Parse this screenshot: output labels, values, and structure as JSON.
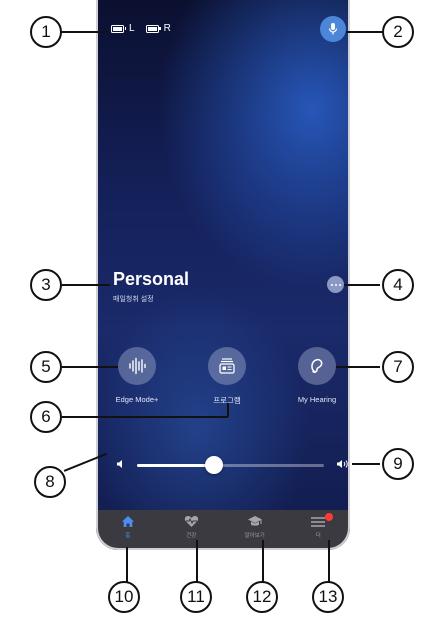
{
  "status": {
    "left_label": "L",
    "right_label": "R"
  },
  "program": {
    "title": "Personal",
    "subtitle": "매일청취 설정"
  },
  "actions": [
    {
      "label": "Edge Mode+",
      "icon": "waveform-icon"
    },
    {
      "label": "프로그램",
      "icon": "program-cards-icon"
    },
    {
      "label": "My Hearing",
      "icon": "ear-icon"
    }
  ],
  "volume": {
    "level": 0.41
  },
  "nav": [
    {
      "label": "홈",
      "icon": "home-icon",
      "active": true
    },
    {
      "label": "건강",
      "icon": "heart-pulse-icon",
      "active": false
    },
    {
      "label": "알아보기",
      "icon": "graduation-cap-icon",
      "active": false
    },
    {
      "label": "더",
      "icon": "menu-icon",
      "active": false,
      "badge": true
    }
  ],
  "callouts": [
    "1",
    "2",
    "3",
    "4",
    "5",
    "6",
    "7",
    "8",
    "9",
    "10",
    "11",
    "12",
    "13"
  ],
  "colors": {
    "accent": "#4c8df0",
    "mic": "#4b86d8",
    "badge": "#ff3a3a"
  }
}
